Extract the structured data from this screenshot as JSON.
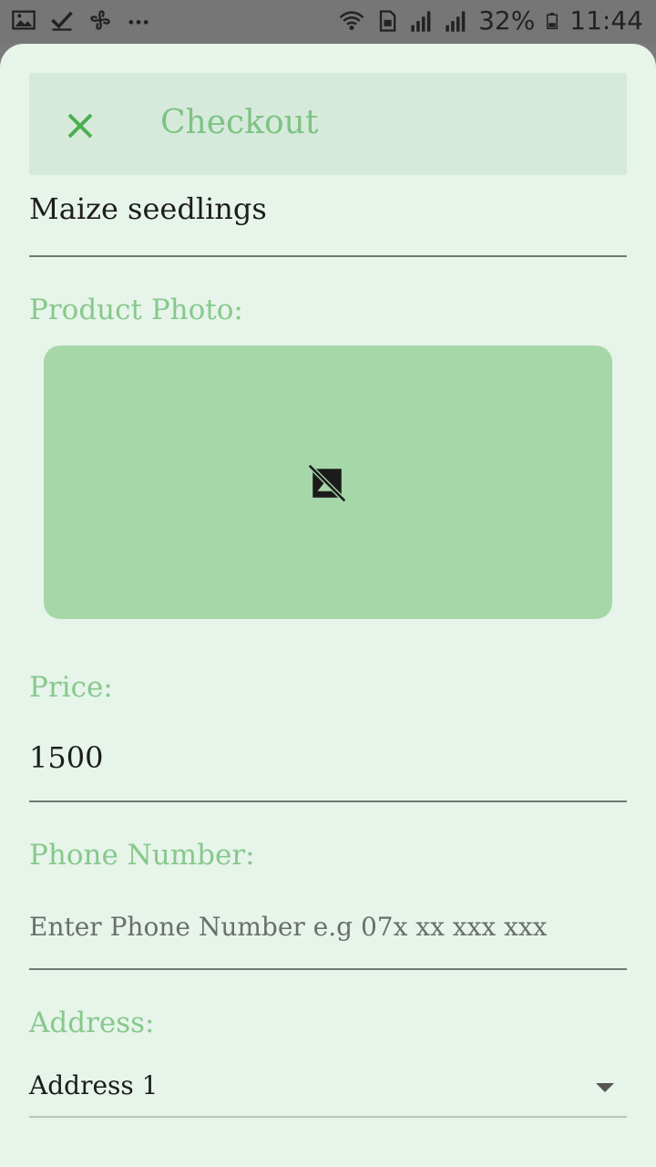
{
  "status_bar": {
    "left_icons": [
      "gallery-icon",
      "checkmark-icon",
      "pinwheel-icon",
      "more-dots-icon"
    ],
    "battery": "32%",
    "time": "11:44"
  },
  "toolbar": {
    "close_icon": "close-icon",
    "title": "Checkout"
  },
  "product": {
    "name": "Maize seedlings",
    "photo_label": "Product Photo:",
    "photo_icon": "broken-image-icon"
  },
  "price": {
    "label": "Price:",
    "value": "1500"
  },
  "phone": {
    "label": "Phone Number:",
    "value": "",
    "placeholder": "Enter Phone Number e.g 07x xx xxx xxx"
  },
  "address": {
    "label": "Address:",
    "selected": "Address 1"
  },
  "colors": {
    "accent": "#7dc383",
    "sheet_background": "#e7f4ea",
    "toolbar_background": "#d6eadc",
    "photo_background": "#a6d7a8"
  }
}
